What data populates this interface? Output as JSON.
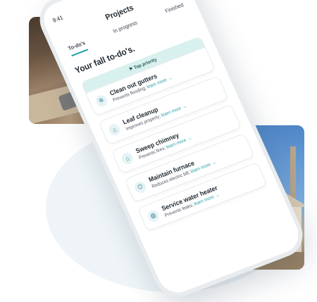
{
  "status_bar": {
    "time": "9:41",
    "icons": "▂▄▆ ≋ ▭"
  },
  "header": {
    "title": "Projects"
  },
  "tabs": [
    {
      "label": "To-do's",
      "active": true
    },
    {
      "label": "In progress",
      "active": false
    },
    {
      "label": "Finished",
      "active": false
    }
  ],
  "heading": "Your fall to-do's.",
  "priority_badge": "Top priority",
  "tasks": [
    {
      "title": "Clean out gutters",
      "desc": "Prevents flooding;",
      "link": "learn more",
      "icon": "gutter-icon"
    },
    {
      "title": "Leaf cleanup",
      "desc": "Improves property;",
      "link": "learn more",
      "icon": "leaf-icon"
    },
    {
      "title": "Sweep chimney",
      "desc": "Prevents fires;",
      "link": "learn more",
      "icon": "chimney-icon"
    },
    {
      "title": "Maintain furnace",
      "desc": "Reduces electric bill;",
      "link": "learn more",
      "icon": "furnace-icon"
    },
    {
      "title": "Service water heater",
      "desc": "Prevents leaks;",
      "link": "learn more",
      "icon": "water-heater-icon"
    }
  ],
  "colors": {
    "accent": "#2a9fa8",
    "priority_bg": "#d9f1ee",
    "background_circle": "#eef4f7"
  }
}
